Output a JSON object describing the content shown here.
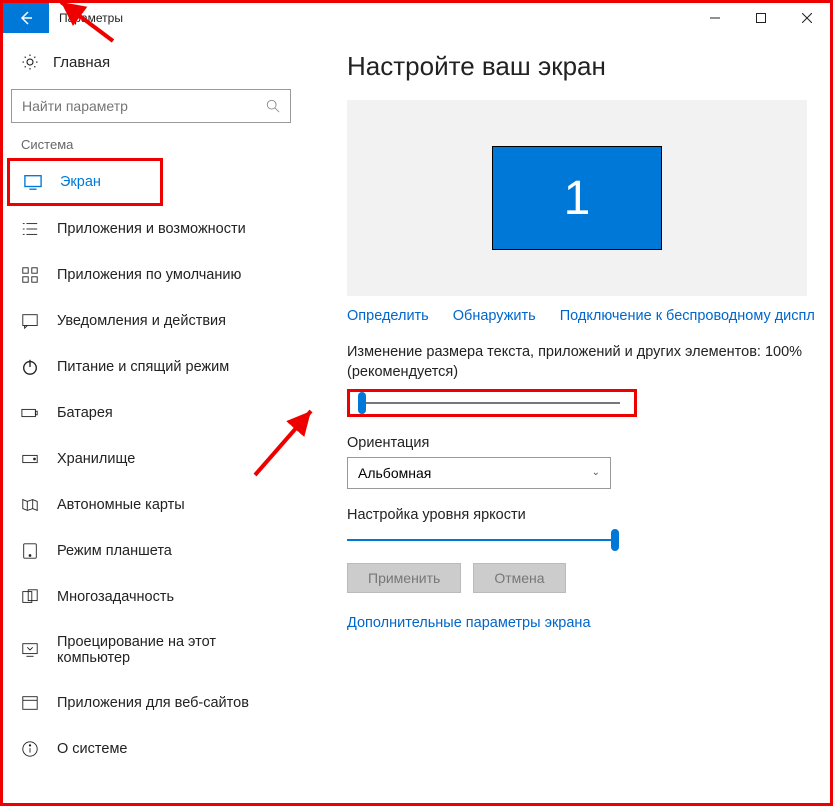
{
  "titlebar": {
    "title": "Параметры"
  },
  "sidebar": {
    "home": "Главная",
    "search_placeholder": "Найти параметр",
    "group": "Система",
    "items": [
      {
        "label": "Экран"
      },
      {
        "label": "Приложения и возможности"
      },
      {
        "label": "Приложения по умолчанию"
      },
      {
        "label": "Уведомления и действия"
      },
      {
        "label": "Питание и спящий режим"
      },
      {
        "label": "Батарея"
      },
      {
        "label": "Хранилище"
      },
      {
        "label": "Автономные карты"
      },
      {
        "label": "Режим планшета"
      },
      {
        "label": "Многозадачность"
      },
      {
        "label": "Проецирование на этот компьютер"
      },
      {
        "label": "Приложения для веб-сайтов"
      },
      {
        "label": "О системе"
      }
    ]
  },
  "main": {
    "heading": "Настройте ваш экран",
    "monitor_number": "1",
    "detect": "Определить",
    "identify": "Обнаружить",
    "wireless": "Подключение к беспроводному диспл",
    "scale_text": "Изменение размера текста, приложений и других элементов: 100% (рекомендуется)",
    "orientation_label": "Ориентация",
    "orientation_value": "Альбомная",
    "brightness_label": "Настройка уровня яркости",
    "apply": "Применить",
    "cancel": "Отмена",
    "advanced": "Дополнительные параметры экрана"
  }
}
